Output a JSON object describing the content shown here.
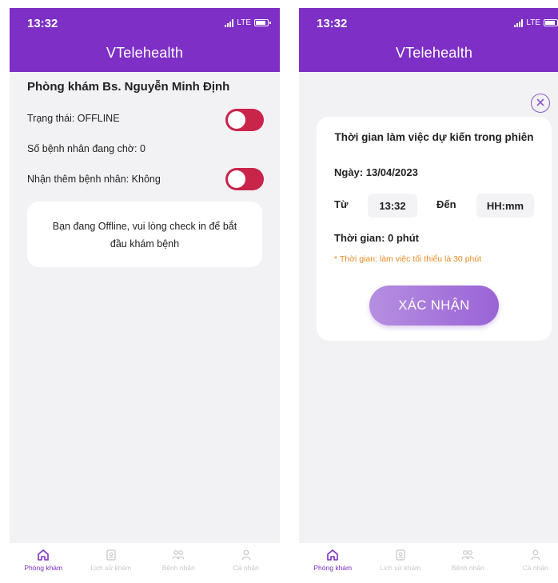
{
  "status_bar": {
    "time": "13:32",
    "network": "LTE"
  },
  "app": {
    "title": "VTelehealth"
  },
  "clinic_screen": {
    "title": "Phòng khám Bs. Nguyễn Minh Định",
    "status_label": "Trạng thái: OFFLINE",
    "status_toggle_on": false,
    "waiting_label": "Số bệnh nhân đang chờ: 0",
    "accept_label": "Nhận thêm bệnh nhân: Không",
    "accept_toggle_on": false,
    "info_message": "Bạn đang Offline, vui lòng check in để bắt đầu khám bệnh"
  },
  "checkin_modal": {
    "title": "Thời gian làm việc dự kiến trong phiên",
    "date_label": "Ngày: 13/04/2023",
    "from_label": "Từ",
    "from_value": "13:32",
    "to_label": "Đến",
    "to_placeholder": "HH:mm",
    "duration_label": "Thời gian: 0 phút",
    "note": "* Thời gian: làm việc tối thiểu là 30 phút",
    "confirm_label": "XÁC NHẬN"
  },
  "bottom_nav": {
    "items": [
      {
        "label": "Phòng khám",
        "icon": "home-icon",
        "active": true
      },
      {
        "label": "Lịch sử khám",
        "icon": "history-icon",
        "active": false
      },
      {
        "label": "Bệnh nhân",
        "icon": "patients-icon",
        "active": false
      },
      {
        "label": "Cá nhân",
        "icon": "profile-icon",
        "active": false
      }
    ]
  },
  "colors": {
    "primary": "#7d2fc6",
    "toggle": "#c9244a",
    "note": "#e88a23",
    "button": "#a374da"
  }
}
